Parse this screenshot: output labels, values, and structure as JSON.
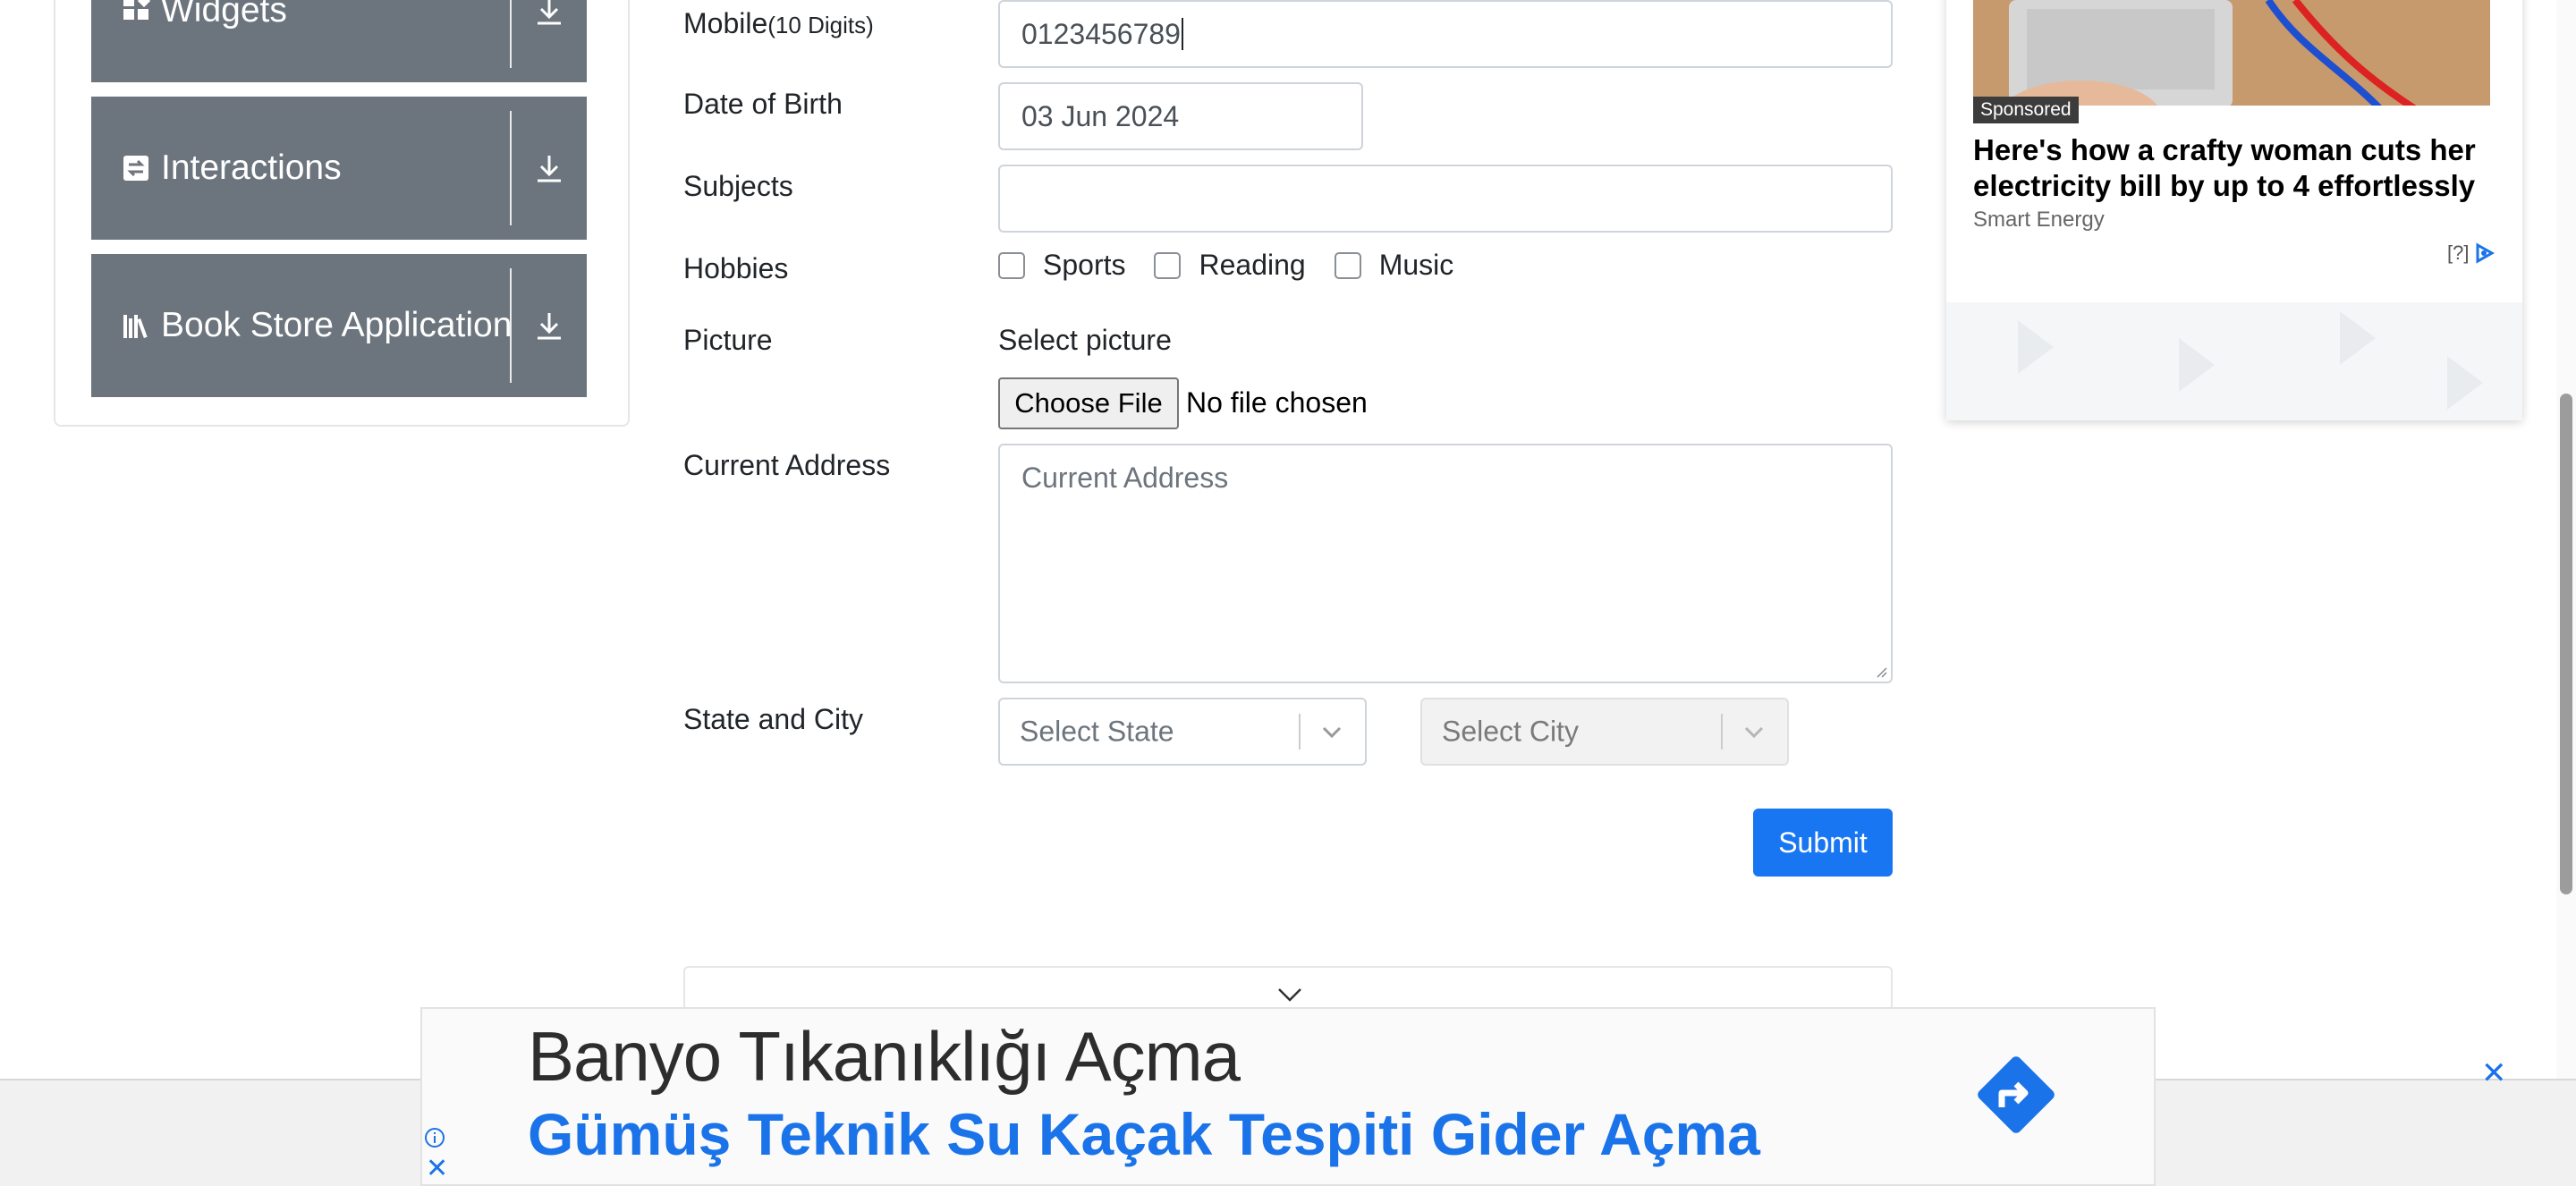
{
  "sidebar": {
    "groups": [
      {
        "label": "Widgets",
        "icon": "widgets-icon"
      },
      {
        "label": "Interactions",
        "icon": "interactions-icon"
      },
      {
        "label": "Book Store Application",
        "icon": "books-icon"
      }
    ]
  },
  "form": {
    "mobile": {
      "label": "Mobile",
      "hint": "(10 Digits)",
      "value": "0123456789"
    },
    "dob": {
      "label": "Date of Birth",
      "value": "03 Jun 2024"
    },
    "subjects": {
      "label": "Subjects",
      "value": ""
    },
    "hobbies": {
      "label": "Hobbies",
      "options": [
        {
          "label": "Sports",
          "checked": false
        },
        {
          "label": "Reading",
          "checked": false
        },
        {
          "label": "Music",
          "checked": false
        }
      ]
    },
    "picture": {
      "label": "Picture",
      "caption": "Select picture",
      "button": "Choose File",
      "status": "No file chosen"
    },
    "address": {
      "label": "Current Address",
      "placeholder": "Current Address"
    },
    "state_city": {
      "label": "State and City",
      "state_placeholder": "Select State",
      "city_placeholder": "Select City"
    },
    "submit": "Submit"
  },
  "ad_right": {
    "badge": "Sponsored",
    "headline": "Here's how a crafty woman cuts her electricity bill by up to 4 effortlessly",
    "source": "Smart Energy",
    "info": "[?]"
  },
  "ad_bottom": {
    "title": "Banyo Tıkanıklığı Açma",
    "subtitle": "Gümüş Teknik Su Kaçak Tespiti Gider Açma"
  },
  "colors": {
    "accent": "#1976f2",
    "nav_group_bg": "#6c757d",
    "ad_link": "#1a73e8"
  }
}
